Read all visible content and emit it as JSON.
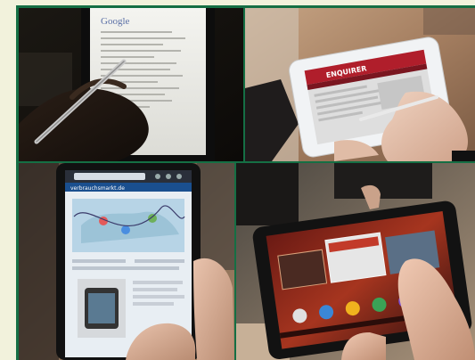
{
  "photos": {
    "top_left": {
      "brand": "Google"
    },
    "top_right": {
      "header": "ENQUIRER"
    },
    "bottom_left": {
      "url": "verbrauchsmarkt.de"
    },
    "bottom_right": {}
  }
}
